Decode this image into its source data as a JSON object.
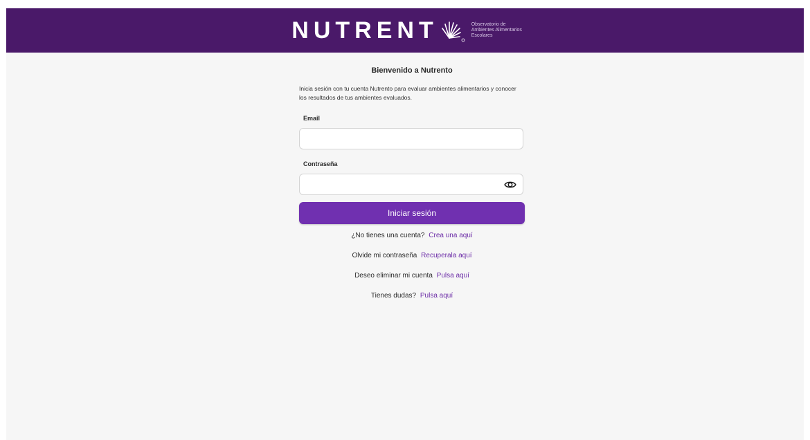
{
  "header": {
    "brand_name": "NUTRENT",
    "tagline_lines": [
      "Observatorio de",
      "Ambientes Alimentarios",
      "Escolares"
    ],
    "background_color": "#4a1969"
  },
  "login": {
    "title": "Bienvenido a Nutrento",
    "intro": "Inicia sesión con tu cuenta Nutrento para evaluar ambientes alimentarios y conocer los resultados de tus ambientes evaluados.",
    "email_label": "Email",
    "email_value": "",
    "password_label": "Contraseña",
    "password_value": "",
    "password_toggle_icon": "eye-icon",
    "submit_label": "Iniciar sesión",
    "accent_color": "#7030b0"
  },
  "links": [
    {
      "text": "¿No tienes una cuenta?",
      "link": "Crea una aquí"
    },
    {
      "text": "Olvide mi contraseña",
      "link": "Recuperala aquí"
    },
    {
      "text": "Deseo eliminar mi cuenta",
      "link": "Pulsa aquí"
    },
    {
      "text": "Tienes dudas?",
      "link": "Pulsa aquí"
    }
  ]
}
